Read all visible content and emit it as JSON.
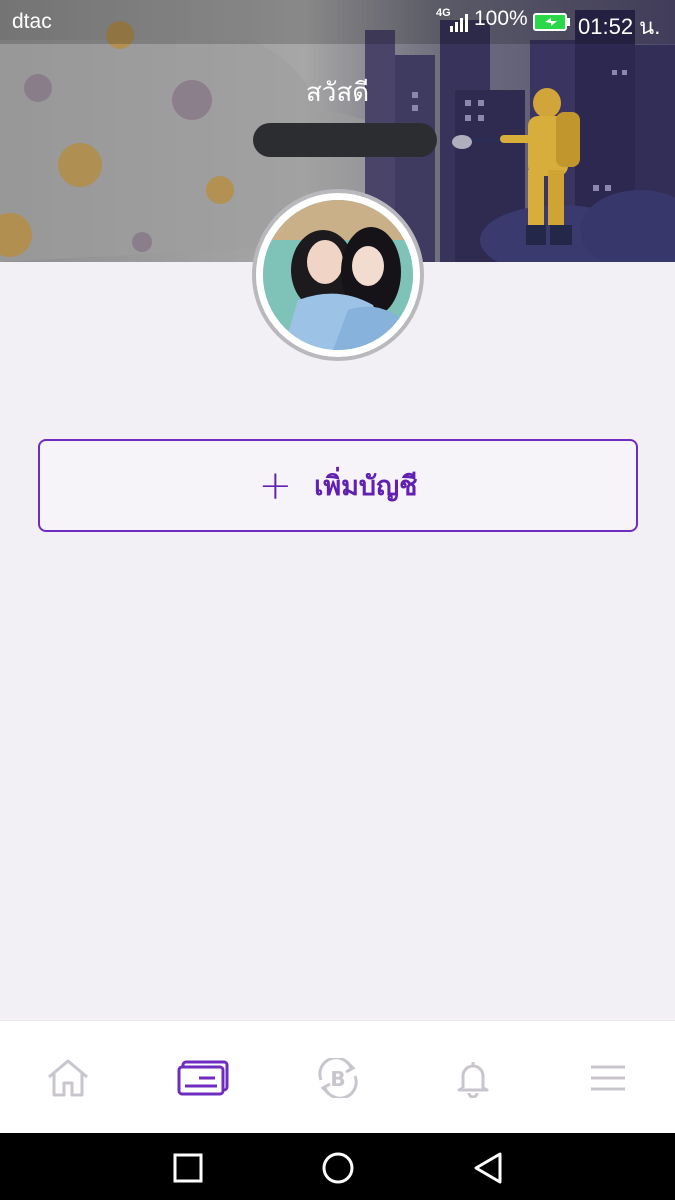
{
  "status_bar": {
    "carrier": "dtac",
    "network": "4G",
    "battery_percent": "100%",
    "time": "01:52 น."
  },
  "header": {
    "greeting": "สวัสดี"
  },
  "add_account": {
    "plus": "+",
    "label": "เพิ่มบัญชี"
  },
  "bottom_nav": {
    "items": [
      {
        "icon": "home-icon",
        "active": false
      },
      {
        "icon": "card-icon",
        "active": true
      },
      {
        "icon": "baht-exchange-icon",
        "active": false
      },
      {
        "icon": "bell-icon",
        "active": false
      },
      {
        "icon": "menu-icon",
        "active": false
      }
    ]
  },
  "colors": {
    "accent": "#6f2cc0",
    "background": "#f3f0f5",
    "inactive_icon": "#c9c5cc"
  }
}
